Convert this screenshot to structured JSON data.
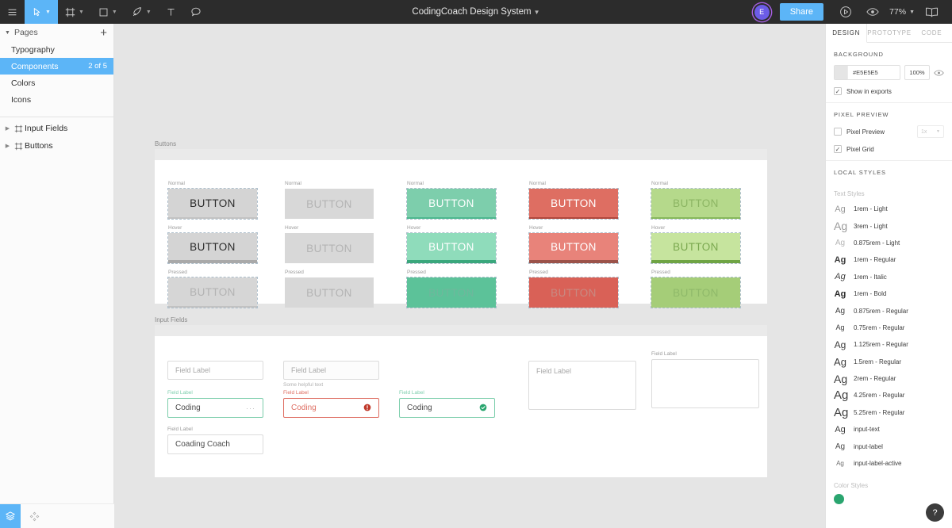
{
  "topbar": {
    "menu_icon": "hamburger-icon",
    "tools": [
      {
        "name": "move-tool",
        "icon": "cursor-icon",
        "has_caret": true,
        "active": true
      },
      {
        "name": "frame-tool",
        "icon": "frame-icon",
        "has_caret": true,
        "active": false
      },
      {
        "name": "shape-tool",
        "icon": "square-icon",
        "has_caret": true,
        "active": false
      },
      {
        "name": "pen-tool",
        "icon": "pen-icon",
        "has_caret": true,
        "active": false
      },
      {
        "name": "text-tool",
        "icon": "text-icon",
        "has_caret": false,
        "active": false
      },
      {
        "name": "comment-tool",
        "icon": "comment-icon",
        "has_caret": false,
        "active": false
      }
    ],
    "title": "CodingCoach Design System",
    "avatar_initial": "E",
    "share_label": "Share",
    "present_icon": "play-icon",
    "view_icon": "eye-icon",
    "zoom_level": "77%",
    "library_icon": "book-icon"
  },
  "sidebar": {
    "pages_header": "Pages",
    "add_page_label": "+",
    "pages": [
      {
        "label": "Typography",
        "count": "",
        "selected": false
      },
      {
        "label": "Components",
        "count": "2 of 5",
        "selected": true
      },
      {
        "label": "Colors",
        "count": "",
        "selected": false
      },
      {
        "label": "Icons",
        "count": "",
        "selected": false
      }
    ],
    "layers": [
      {
        "label": "Input Fields",
        "icon": "component-frame-icon"
      },
      {
        "label": "Buttons",
        "icon": "component-frame-icon"
      }
    ],
    "bottom": {
      "layers_icon": "layers-icon",
      "plugins_icon": "plugin-icon"
    }
  },
  "canvas": {
    "frames": [
      {
        "title": "Buttons",
        "columns": [
          {
            "variant": "default",
            "bg": "#d4d4d4",
            "text_color": "#2b2b2b",
            "border_color": "#bdbdbd",
            "states": [
              {
                "label": "Normal",
                "bg": "#d4d4d4",
                "text": "BUTTON",
                "text_color": "#2b2b2b",
                "border": "#c2c2c2",
                "border_w": 2,
                "selected": true
              },
              {
                "label": "Hover",
                "bg": "#d4d4d4",
                "text": "BUTTON",
                "text_color": "#2b2b2b",
                "border": "#a9a9a9",
                "border_w": 4,
                "selected": true
              },
              {
                "label": "Pressed",
                "bg": "#d6d6d6",
                "text": "BUTTON",
                "text_color": "#b3b3b3",
                "border": "#c2c2c2",
                "border_w": 2,
                "selected": true
              }
            ]
          },
          {
            "variant": "disabled",
            "bg": "#d8d8d8",
            "text_color": "#b3b3b3",
            "border_color": "#d8d8d8",
            "states": [
              {
                "label": "Normal",
                "bg": "#d8d8d8",
                "text": "BUTTON",
                "text_color": "#b3b3b3",
                "border": "#d8d8d8",
                "border_w": 0,
                "selected": false
              },
              {
                "label": "Hover",
                "bg": "#d8d8d8",
                "text": "BUTTON",
                "text_color": "#b3b3b3",
                "border": "#d8d8d8",
                "border_w": 0,
                "selected": false
              },
              {
                "label": "Pressed",
                "bg": "#d8d8d8",
                "text": "BUTTON",
                "text_color": "#b3b3b3",
                "border": "#d8d8d8",
                "border_w": 0,
                "selected": false
              }
            ]
          },
          {
            "variant": "primary-green",
            "bg": "#7dceac",
            "text_color": "#ffffff",
            "border_color": "#3fae84",
            "states": [
              {
                "label": "Normal",
                "bg": "#7dceac",
                "text": "BUTTON",
                "text_color": "#ffffff",
                "border": "#4cb78f",
                "border_w": 2,
                "selected": true
              },
              {
                "label": "Hover",
                "bg": "#8fdcbb",
                "text": "BUTTON",
                "text_color": "#ffffff",
                "border": "#3aa77c",
                "border_w": 4,
                "selected": true
              },
              {
                "label": "Pressed",
                "bg": "#5cc299",
                "text": "BUTTON",
                "text_color": "#6fb79c",
                "border": "#5cc299",
                "border_w": 0,
                "selected": true
              }
            ]
          },
          {
            "variant": "danger-red",
            "bg": "#de6e62",
            "text_color": "#ffffff",
            "border_color": "#b8483d",
            "states": [
              {
                "label": "Normal",
                "bg": "#de6e62",
                "text": "BUTTON",
                "text_color": "#ffffff",
                "border": "#b0473c",
                "border_w": 2,
                "selected": true
              },
              {
                "label": "Hover",
                "bg": "#e8837a",
                "text": "BUTTON",
                "text_color": "#ffffff",
                "border": "#9b5249",
                "border_w": 4,
                "selected": true
              },
              {
                "label": "Pressed",
                "bg": "#d96157",
                "text": "BUTTON",
                "text_color": "#c88a82",
                "border": "#d96157",
                "border_w": 0,
                "selected": true
              }
            ]
          },
          {
            "variant": "secondary-lime",
            "bg": "#b5d98b",
            "text_color": "#6c9a46",
            "border_color": "#83b755",
            "states": [
              {
                "label": "Normal",
                "bg": "#b5d98b",
                "text": "BUTTON",
                "text_color": "#8cb563",
                "border": "#86b85a",
                "border_w": 2,
                "selected": true
              },
              {
                "label": "Hover",
                "bg": "#c6e49e",
                "text": "BUTTON",
                "text_color": "#7aa84f",
                "border": "#6fa444",
                "border_w": 4,
                "selected": true
              },
              {
                "label": "Pressed",
                "bg": "#a5cd78",
                "text": "BUTTON",
                "text_color": "#8fb96a",
                "border": "#a5cd78",
                "border_w": 0,
                "selected": true
              }
            ]
          }
        ]
      },
      {
        "title": "Input Fields",
        "fields": [
          {
            "kind": "input",
            "label": "",
            "placeholder": "Field Label",
            "value": "",
            "help": "",
            "state": "empty"
          },
          {
            "kind": "input",
            "label": "",
            "placeholder": "Field Label",
            "value": "",
            "help": "Some helpful text",
            "state": "empty-help"
          },
          {
            "kind": "input",
            "label": "Field Label",
            "placeholder": "",
            "value": "Coding",
            "help": "",
            "state": "active",
            "trailing": "dots-icon"
          },
          {
            "kind": "input",
            "label": "Field Label",
            "placeholder": "",
            "value": "Coding",
            "help": "",
            "state": "error",
            "trailing": "error-icon"
          },
          {
            "kind": "input",
            "label": "Field Label",
            "placeholder": "",
            "value": "Coding",
            "help": "",
            "state": "success",
            "trailing": "check-icon"
          },
          {
            "kind": "input",
            "label": "Field Label",
            "placeholder": "",
            "value": "Coading Coach",
            "help": "",
            "state": "filled"
          },
          {
            "kind": "textarea",
            "label": "",
            "placeholder": "Field Label",
            "value": "",
            "help": "",
            "state": "empty"
          },
          {
            "kind": "textarea",
            "label": "Field Label",
            "placeholder": "",
            "value": "",
            "help": "",
            "state": "empty"
          }
        ]
      }
    ]
  },
  "inspector": {
    "tabs": [
      {
        "label": "DESIGN",
        "active": true
      },
      {
        "label": "PROTOTYPE",
        "active": false
      },
      {
        "label": "CODE",
        "active": false
      }
    ],
    "background": {
      "title": "BACKGROUND",
      "hex": "#E5E5E5",
      "swatch_color": "#E5E5E5",
      "opacity": "100%",
      "visibility_icon": "eye-icon",
      "show_in_exports": {
        "label": "Show in exports",
        "checked": true
      }
    },
    "pixel_preview": {
      "title": "PIXEL PREVIEW",
      "pixel_preview": {
        "label": "Pixel Preview",
        "checked": false
      },
      "scale": "1x",
      "pixel_grid": {
        "label": "Pixel Grid",
        "checked": true
      }
    },
    "local_styles": {
      "title": "LOCAL STYLES",
      "text_styles_label": "Text Styles",
      "text_styles": [
        {
          "preview": "Ag",
          "name": "1rem - Light",
          "size": 11,
          "weight": 300,
          "color": "#9a9a9a",
          "style": "normal"
        },
        {
          "preview": "Ag",
          "name": "3rem - Light",
          "size": 14,
          "weight": 300,
          "color": "#9a9a9a",
          "style": "normal"
        },
        {
          "preview": "Ag",
          "name": "0.875rem - Light",
          "size": 10,
          "weight": 300,
          "color": "#b5b5b5",
          "style": "normal"
        },
        {
          "preview": "Ag",
          "name": "1rem - Regular",
          "size": 11,
          "weight": 600,
          "color": "#3c3c3c",
          "style": "normal"
        },
        {
          "preview": "Ag",
          "name": "1rem - Italic",
          "size": 11,
          "weight": 500,
          "color": "#3c3c3c",
          "style": "italic"
        },
        {
          "preview": "Ag",
          "name": "1rem - Bold",
          "size": 11,
          "weight": 700,
          "color": "#2b2b2b",
          "style": "normal"
        },
        {
          "preview": "Ag",
          "name": "0.875rem - Regular",
          "size": 10,
          "weight": 500,
          "color": "#3c3c3c",
          "style": "normal"
        },
        {
          "preview": "Ag",
          "name": "0.75rem - Regular",
          "size": 9,
          "weight": 500,
          "color": "#3c3c3c",
          "style": "normal"
        },
        {
          "preview": "Ag",
          "name": "1.125rem - Regular",
          "size": 12,
          "weight": 500,
          "color": "#3c3c3c",
          "style": "normal"
        },
        {
          "preview": "Ag",
          "name": "1.5rem - Regular",
          "size": 13,
          "weight": 500,
          "color": "#3c3c3c",
          "style": "normal"
        },
        {
          "preview": "Ag",
          "name": "2rem - Regular",
          "size": 14,
          "weight": 500,
          "color": "#3c3c3c",
          "style": "normal"
        },
        {
          "preview": "Ag",
          "name": "4.25rem - Regular",
          "size": 15,
          "weight": 500,
          "color": "#3c3c3c",
          "style": "normal"
        },
        {
          "preview": "Ag",
          "name": "5.25rem - Regular",
          "size": 15,
          "weight": 500,
          "color": "#3c3c3c",
          "style": "normal"
        },
        {
          "preview": "Ag",
          "name": "input-text",
          "size": 11,
          "weight": 500,
          "color": "#3c3c3c",
          "style": "normal"
        },
        {
          "preview": "Ag",
          "name": "input-label",
          "size": 10,
          "weight": 400,
          "color": "#4c4c4c",
          "style": "normal"
        },
        {
          "preview": "Ag",
          "name": "input-label-active",
          "size": 8,
          "weight": 400,
          "color": "#6c6c6c",
          "style": "normal"
        }
      ],
      "color_styles_label": "Color Styles",
      "color_styles": [
        {
          "swatch": "#2aa56f",
          "name": ""
        }
      ]
    },
    "help_label": "?"
  }
}
